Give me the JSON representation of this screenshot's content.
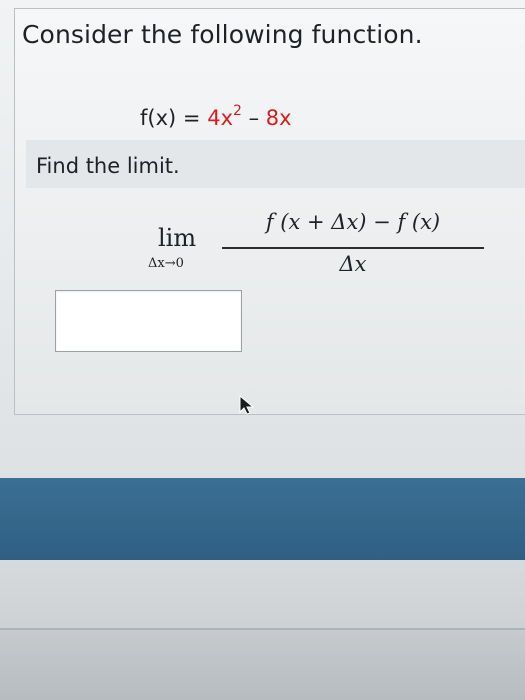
{
  "question": {
    "title": "Consider the following function.",
    "function": {
      "lhs": "f(x)",
      "eq": "=",
      "term1": "4x",
      "exp": "2",
      "minus": "–",
      "term2": "8x"
    },
    "instruction": "Find the limit.",
    "limit": {
      "word": "lim",
      "subscript": "Δx→0",
      "numerator": "f (x + Δx) − f (x)",
      "denominator": "Δx"
    }
  },
  "answer": {
    "value": ""
  },
  "colors": {
    "accent_red": "#d81e1e",
    "bar_blue": "#30607f"
  }
}
